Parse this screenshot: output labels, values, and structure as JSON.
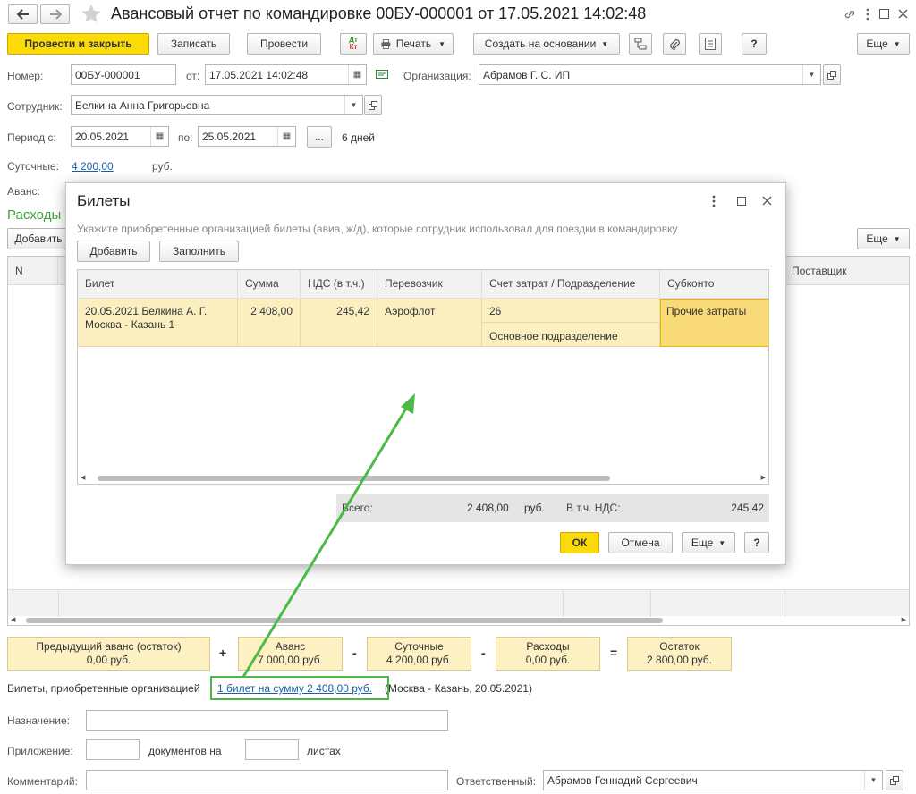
{
  "window": {
    "title": "Авансовый отчет по командировке 00БУ-000001 от 17.05.2021 14:02:48"
  },
  "toolbar": {
    "post_close": "Провести и закрыть",
    "save": "Записать",
    "post": "Провести",
    "print": "Печать",
    "create_based": "Создать на основании",
    "help": "?",
    "more": "Еще",
    "dt_kt_top": "Дт",
    "dt_kt_bottom": "Кт"
  },
  "form": {
    "number_label": "Номер:",
    "number_value": "00БУ-000001",
    "date_label": "от:",
    "date_value": "17.05.2021 14:02:48",
    "org_label": "Организация:",
    "org_value": "Абрамов Г. С. ИП",
    "employee_label": "Сотрудник:",
    "employee_value": "Белкина Анна Григорьевна",
    "period_label": "Период с:",
    "period_from": "20.05.2021",
    "period_to_label": "по:",
    "period_to": "25.05.2021",
    "period_btn": "...",
    "days": "6 дней",
    "daily_label": "Суточные:",
    "daily_value": "4 200,00",
    "daily_currency": "руб.",
    "advance_label": "Аванс:",
    "expenses_label": "Расходы",
    "add_label": "Добавить",
    "more_label": "Еще",
    "col_n": "N",
    "col_supplier": "Поставщик"
  },
  "summary": [
    {
      "title": "Предыдущий аванс (остаток)",
      "value": "0,00 руб."
    },
    {
      "title": "Аванс",
      "value": "7 000,00 руб."
    },
    {
      "title": "Суточные",
      "value": "4 200,00 руб."
    },
    {
      "title": "Расходы",
      "value": "0,00 руб."
    },
    {
      "title": "Остаток",
      "value": "2 800,00 руб."
    }
  ],
  "ops": [
    "+",
    "-",
    "-",
    "="
  ],
  "tickets": {
    "label": "Билеты, приобретенные организацией",
    "link": "1 билет на сумму 2 408,00 руб.",
    "rest": " (Москва - Казань, 20.05.2021)"
  },
  "bottom": {
    "purpose_label": "Назначение:",
    "attach_label": "Приложение:",
    "docs_label": "документов на",
    "sheets_label": "листах",
    "comment_label": "Комментарий:",
    "responsible_label": "Ответственный:",
    "responsible_value": "Абрамов Геннадий Сергеевич"
  },
  "dialog": {
    "title": "Билеты",
    "hint": "Укажите приобретенные организацией билеты (авиа, ж/д), которые сотрудник использовал для поездки в командировку",
    "add": "Добавить",
    "fill": "Заполнить",
    "columns": [
      "Билет",
      "Сумма",
      "НДС (в т.ч.)",
      "Перевозчик",
      "Счет затрат / Подразделение",
      "Субконто"
    ],
    "row": {
      "ticket1": "20.05.2021 Белкина А. Г.",
      "ticket2": "Москва - Казань 1",
      "sum": "2 408,00",
      "vat": "245,42",
      "carrier": "Аэрофлот",
      "account": "26",
      "department": "Основное подразделение",
      "subconto": "Прочие затраты"
    },
    "total_label": "Всего:",
    "total_value": "2 408,00",
    "total_currency": "руб.",
    "vat_label": "В т.ч. НДС:",
    "vat_value": "245,42",
    "ok": "ОК",
    "cancel": "Отмена",
    "more": "Еще",
    "help": "?"
  },
  "colors": {
    "accent_yellow": "#fbdb07",
    "link": "#1d5fa5",
    "green_arrow": "#4cba46",
    "expenses_green": "#3fa33b"
  }
}
